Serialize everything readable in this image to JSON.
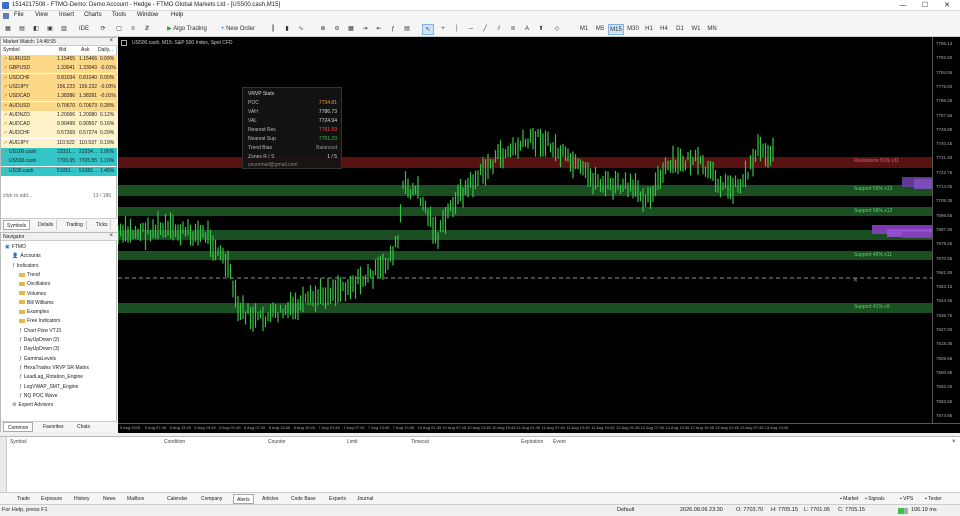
{
  "window": {
    "title": "1514217508 - FTMO-Demo: Demo Account - Hedge - FTMO Global Markets Ltd - [US500.cash,M15]",
    "min": "—",
    "max": "☐",
    "close": "✕"
  },
  "menu": [
    "File",
    "View",
    "Insert",
    "Charts",
    "Tools",
    "Window",
    "Help"
  ],
  "toolbar": {
    "ide": "IDE",
    "algo": "Algo Trading",
    "neworder": "New Order",
    "timeframes": [
      "M1",
      "M5",
      "M15",
      "M30",
      "H1",
      "H4",
      "D1",
      "W1",
      "MN"
    ],
    "active_tf": "M15"
  },
  "market_watch": {
    "header": "Market Watch: 14:48:55",
    "cols": [
      "Symbol",
      "Bid",
      "Ask",
      "Daily..."
    ],
    "rows": [
      {
        "s": "EURUSD",
        "b": "1.15455",
        "a": "1.15466",
        "d": "0.09%"
      },
      {
        "s": "GBPUSD",
        "b": "1.33041",
        "a": "1.33043",
        "d": "-0.01%"
      },
      {
        "s": "USDCHF",
        "b": "0.81034",
        "a": "0.81040",
        "d": "0.00%"
      },
      {
        "s": "USDJPY",
        "b": "156.223",
        "a": "156.232",
        "d": "-0.03%"
      },
      {
        "s": "USDCAD",
        "b": "1.38386",
        "a": "1.38391",
        "d": "-0.01%"
      },
      {
        "s": "AUDUSD",
        "b": "0.70670",
        "a": "0.70673",
        "d": "0.28%"
      },
      {
        "s": "AUDNZD",
        "b": "1.20066",
        "a": "1.20080",
        "d": "0.12%"
      },
      {
        "s": "AUDCAD",
        "b": "0.90499",
        "a": "0.90507",
        "d": "0.16%"
      },
      {
        "s": "AUDCHF",
        "b": "0.57269",
        "a": "0.57274",
        "d": "0.29%"
      },
      {
        "s": "AUDJPY",
        "b": "110.522",
        "a": "110.537",
        "d": "0.19%"
      },
      {
        "s": "US100.cash",
        "b": "23331...",
        "a": "23334...",
        "d": "1.06%"
      },
      {
        "s": "US500.cash",
        "b": "7705.65",
        "a": "7705.55",
        "d": "1.10%"
      },
      {
        "s": "US30.cash",
        "b": "51051...",
        "a": "51082...",
        "d": "1.45%"
      }
    ],
    "add": "click to add...",
    "count": "13 / 186",
    "tabs": [
      "Symbols",
      "Details",
      "Trading",
      "Ticks"
    ]
  },
  "navigator": {
    "header": "Navigator",
    "items": [
      {
        "t": "FTMO",
        "lvl": 0,
        "type": "root"
      },
      {
        "t": "Accounts",
        "lvl": 1,
        "type": "acc"
      },
      {
        "t": "Indicators",
        "lvl": 1,
        "type": "ind"
      },
      {
        "t": "Trend",
        "lvl": 2,
        "type": "folder"
      },
      {
        "t": "Oscillators",
        "lvl": 2,
        "type": "folder"
      },
      {
        "t": "Volumes",
        "lvl": 2,
        "type": "folder"
      },
      {
        "t": "Bill Williams",
        "lvl": 2,
        "type": "folder"
      },
      {
        "t": "Examples",
        "lvl": 2,
        "type": "folder"
      },
      {
        "t": "Free Indicators",
        "lvl": 2,
        "type": "folder"
      },
      {
        "t": "Chart Flow VTJ3",
        "lvl": 2,
        "type": "ind"
      },
      {
        "t": "DayUpDown (2)",
        "lvl": 2,
        "type": "ind"
      },
      {
        "t": "DayUpDown (3)",
        "lvl": 2,
        "type": "ind"
      },
      {
        "t": "GammaLevels",
        "lvl": 2,
        "type": "ind"
      },
      {
        "t": "HexaTrades VRVP SR Matrix",
        "lvl": 2,
        "type": "ind"
      },
      {
        "t": "LeadLag_Rotation_Engine",
        "lvl": 2,
        "type": "ind"
      },
      {
        "t": "LogVWAP_SMT_Engine",
        "lvl": 2,
        "type": "ind"
      },
      {
        "t": "NQ POC Wave",
        "lvl": 2,
        "type": "ind"
      },
      {
        "t": "Expert Advisors",
        "lvl": 1,
        "type": "ea"
      }
    ],
    "tabs": [
      "Common",
      "Favorites",
      "Chats"
    ]
  },
  "chart": {
    "label": "US500.cash, M15: S&P 500 Index, Spot CFD",
    "vwap": {
      "title": "VRVP Stats",
      "rows": [
        {
          "k": "POC",
          "v": "7734.81",
          "c": "#ff9a3c"
        },
        {
          "k": "VAH",
          "v": "7786.73",
          "c": "#dddddd"
        },
        {
          "k": "VAL",
          "v": "7724.94",
          "c": "#dddddd"
        },
        {
          "k": "Nearest Res",
          "v": "7761.59",
          "c": "#ff4a4a"
        },
        {
          "k": "Nearest Sup",
          "v": "7751.23",
          "c": "#3cc04a"
        },
        {
          "k": "Trend Bias",
          "v": "Balanced",
          "c": "#999999"
        },
        {
          "k": "Zones R / S",
          "v": "1 / 5",
          "c": "#dddddd"
        }
      ],
      "footer": "youremail@gmail.com"
    },
    "zones": [
      {
        "label": "Resistance 51%  x11",
        "color": "#a22020"
      },
      {
        "label": "Support 59%  x13",
        "color": "#2e8f3c"
      },
      {
        "label": "Support 58%  x12",
        "color": "#2e8f3c"
      },
      {
        "label": "Support 45%  x11",
        "color": "#2e8f3c"
      },
      {
        "label": "Support 41%  x9",
        "color": "#2e8f3c"
      }
    ],
    "price_labels": [
      "7796.13",
      "7792.50",
      "7784.55",
      "7775.60",
      "7766.25",
      "7757.55",
      "7748.85",
      "7740.15",
      "7731.45",
      "7722.75",
      "7714.05",
      "7705.35",
      "7696.65",
      "7687.95",
      "7679.25",
      "7670.55",
      "7661.85",
      "7653.15",
      "7644.45",
      "7635.75",
      "7627.05",
      "7618.35",
      "7609.65",
      "7600.95",
      "7592.25",
      "7583.55",
      "7574.85"
    ],
    "time_labels": [
      "5 Aug 2026",
      "5 Aug 07:45",
      "5 Aug 13:45",
      "5 Aug 19:45",
      "6 Aug 01:45",
      "6 Aug 07:45",
      "6 Aug 13:45",
      "6 Aug 19:45",
      "7 Aug 01:45",
      "7 Aug 07:45",
      "7 Aug 13:45",
      "7 Aug 19:45",
      "10 Aug 01:45",
      "10 Aug 07:45",
      "10 Aug 13:45",
      "10 Aug 19:45",
      "11 Aug 01:45",
      "11 Aug 07:45",
      "11 Aug 13:45",
      "11 Aug 19:45",
      "12 Aug 01:45",
      "12 Aug 07:45",
      "12 Aug 13:45",
      "12 Aug 19:45",
      "13 Aug 01:45",
      "13 Aug 07:45",
      "13 Aug 14:45"
    ]
  },
  "alerts": {
    "cols": [
      "Symbol",
      "Condition",
      "Counter",
      "Limit",
      "Timeout",
      "Expiration",
      "Event"
    ]
  },
  "bottom_tabs": [
    "Trade",
    "Exposure",
    "History",
    "News",
    "Mailbox",
    "Calendar",
    "Company",
    "Alerts",
    "Articles",
    "Code Base",
    "Experts",
    "Journal"
  ],
  "active_tab": "Alerts",
  "bottom_right": [
    "Market",
    "Signals",
    "VPS",
    "Tester"
  ],
  "status": {
    "help": "For Help, press F1",
    "profile": "Default",
    "time": "2026.08.06 23:30",
    "o": "O: 7703.70",
    "h": "H: 7705.15",
    "l": "L: 7701.05",
    "c": "C: 7705.15",
    "net": "106.19 ms"
  },
  "colors": {
    "accent": "#cfe3f7",
    "candle": "#3cc04a",
    "resistance": "#a22020",
    "support": "#2e8f3c",
    "profile": "#8a3fc4"
  }
}
